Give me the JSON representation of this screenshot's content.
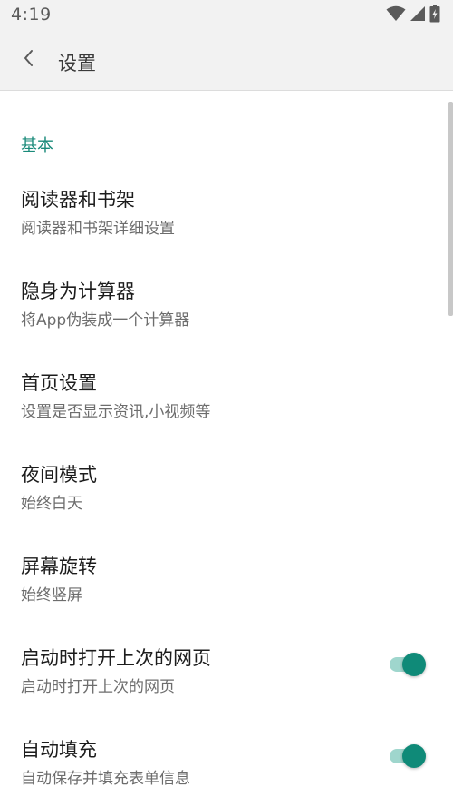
{
  "status_bar": {
    "time": "4:19",
    "icons": [
      "wifi-icon",
      "signal-icon",
      "battery-charging-icon"
    ]
  },
  "app_bar": {
    "back_icon": "chevron-left-icon",
    "title": "设置"
  },
  "section": {
    "title": "基本"
  },
  "settings": [
    {
      "title": "阅读器和书架",
      "summary": "阅读器和书架详细设置",
      "has_switch": false
    },
    {
      "title": "隐身为计算器",
      "summary": "将App伪装成一个计算器",
      "has_switch": false
    },
    {
      "title": "首页设置",
      "summary": "设置是否显示资讯,小视频等",
      "has_switch": false
    },
    {
      "title": "夜间模式",
      "summary": "始终白天",
      "has_switch": false
    },
    {
      "title": "屏幕旋转",
      "summary": "始终竖屏",
      "has_switch": false
    },
    {
      "title": "启动时打开上次的网页",
      "summary": "启动时打开上次的网页",
      "has_switch": true,
      "switch_on": true
    },
    {
      "title": "自动填充",
      "summary": "自动保存并填充表单信息",
      "has_switch": true,
      "switch_on": true
    }
  ],
  "colors": {
    "accent": "#0f8a78",
    "accent_track": "#9fd6cd",
    "section_header": "#1a8a7a",
    "bar_background": "#f2f2f2"
  }
}
